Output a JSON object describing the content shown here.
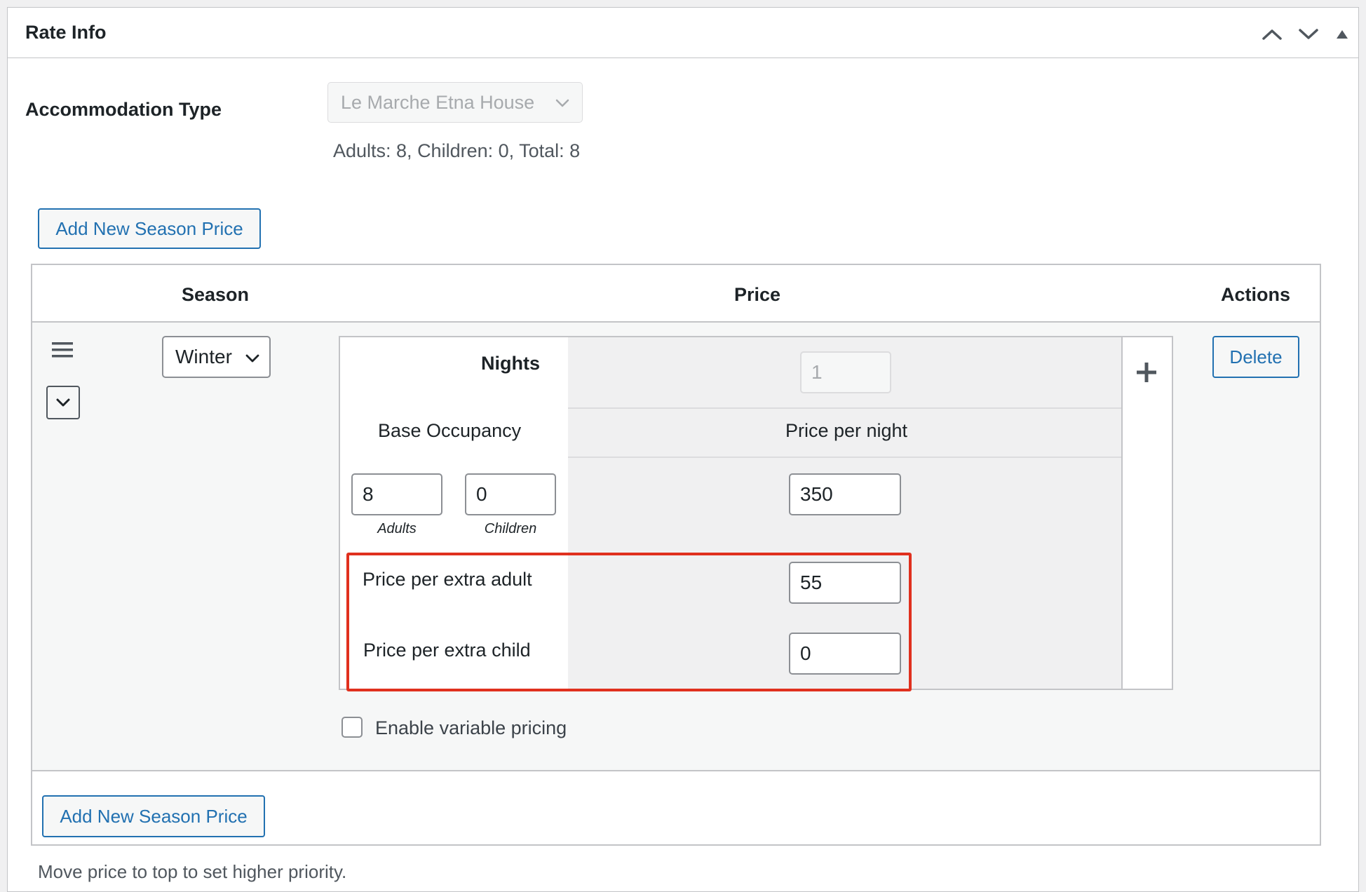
{
  "metabox": {
    "title": "Rate Info",
    "controls": {
      "move_up": "chevron-up-icon",
      "move_down": "chevron-down-icon",
      "toggle": "triangle-up-icon"
    }
  },
  "accommodation": {
    "label": "Accommodation Type",
    "selected": "Le Marche Etna House",
    "capacity_text": "Adults: 8, Children: 0, Total: 8"
  },
  "add_season_label": "Add New Season Price",
  "table": {
    "headers": {
      "season": "Season",
      "price": "Price",
      "actions": "Actions"
    },
    "row": {
      "season_selected": "Winter",
      "nights_label": "Nights",
      "nights_value": "1",
      "base_occupancy_label": "Base Occupancy",
      "price_per_night_label": "Price per night",
      "adults_value": "8",
      "adults_caption": "Adults",
      "children_value": "0",
      "children_caption": "Children",
      "price_per_night_value": "350",
      "extra_adult_label": "Price per extra adult",
      "extra_adult_value": "55",
      "extra_child_label": "Price per extra child",
      "extra_child_value": "0",
      "variable_pricing_label": "Enable variable pricing",
      "variable_pricing_checked": false,
      "delete_label": "Delete"
    }
  },
  "footer_hint": "Move price to top to set higher priority.",
  "colors": {
    "accent": "#2271b1",
    "highlight": "#e0301e"
  }
}
